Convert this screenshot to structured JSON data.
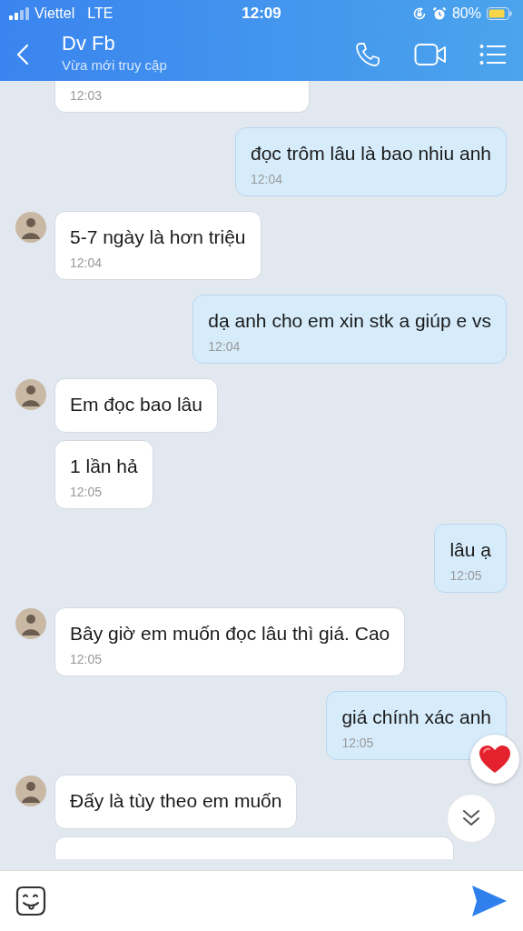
{
  "status_bar": {
    "carrier": "Viettel",
    "network": "LTE",
    "time": "12:09",
    "battery": "80%"
  },
  "header": {
    "title": "Dv Fb",
    "subtitle": "Vừa mới truy cập"
  },
  "messages": [
    {
      "kind": "incoming_cut_top",
      "time": "12:03"
    },
    {
      "kind": "outgoing",
      "text": "đọc trôm lâu là bao nhiu anh",
      "time": "12:04"
    },
    {
      "kind": "incoming",
      "text": "5-7 ngày là hơn triệu",
      "time": "12:04",
      "avatar": true
    },
    {
      "kind": "outgoing",
      "text": "dạ anh cho em xin stk a giúp e vs",
      "time": "12:04"
    },
    {
      "kind": "incoming",
      "text": "Em đọc bao lâu",
      "avatar": true
    },
    {
      "kind": "incoming",
      "text": "1 lần hả",
      "time": "12:05",
      "avatar": false
    },
    {
      "kind": "outgoing",
      "text": "lâu ạ",
      "time": "12:05"
    },
    {
      "kind": "incoming",
      "text": "Bây giờ em muốn đọc lâu thì giá. Cao",
      "time": "12:05",
      "avatar": true
    },
    {
      "kind": "outgoing",
      "text": "giá chính xác anh",
      "time": "12:05",
      "reaction": true
    },
    {
      "kind": "incoming",
      "text": "Đấy là tùy theo em muốn",
      "avatar": true
    },
    {
      "kind": "incoming_cut_bottom"
    }
  ]
}
